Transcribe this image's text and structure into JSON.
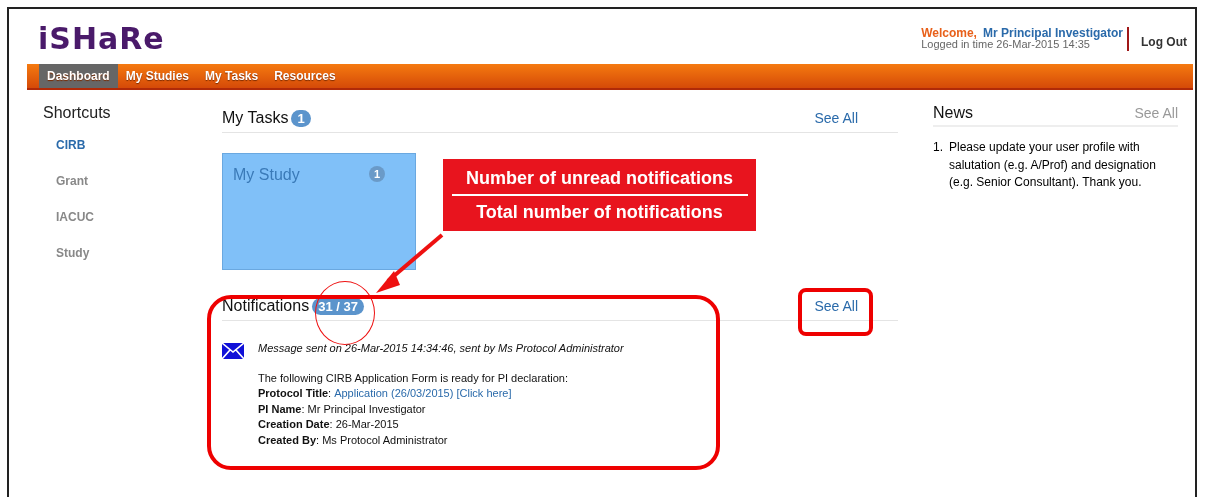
{
  "header": {
    "logo": "iSHaRe",
    "welcome": "Welcome,",
    "user": "Mr Principal Investigator",
    "login_time": "Logged in time 26-Mar-2015 14:35",
    "logout": "Log Out"
  },
  "nav": [
    {
      "label": "Dashboard",
      "selected": true
    },
    {
      "label": "My Studies",
      "selected": false
    },
    {
      "label": "My Tasks",
      "selected": false
    },
    {
      "label": "Resources",
      "selected": false
    }
  ],
  "sidebar": {
    "title": "Shortcuts",
    "items": [
      {
        "label": "CIRB",
        "selected": true
      },
      {
        "label": "Grant",
        "selected": false
      },
      {
        "label": "IACUC",
        "selected": false
      },
      {
        "label": "Study",
        "selected": false
      }
    ]
  },
  "tasks": {
    "title": "My Tasks",
    "count": "1",
    "see_all": "See All",
    "tiles": [
      {
        "label": "My Study",
        "count": "1"
      }
    ]
  },
  "notifications": {
    "title": "Notifications",
    "count": "31 / 37",
    "see_all": "See All",
    "items": [
      {
        "meta": "Message sent on 26-Mar-2015 14:34:46, sent by Ms Protocol Administrator",
        "intro": "The following CIRB Application Form is ready for PI declaration:",
        "fields": [
          {
            "label": "**Protocol Title**:",
            "value": "Application (26/03/2015) [Click here]",
            "kind": "link"
          },
          {
            "text": "**PI Name**: Mr Principal Investigator",
            "kind": "text"
          },
          {
            "text": "**Creation Date**: 26-Mar-2015",
            "kind": "text"
          },
          {
            "text": "**Created By**: Ms Protocol Administrator",
            "kind": "text"
          }
        ]
      }
    ]
  },
  "news": {
    "title": "News",
    "see_all": "See All",
    "items": [
      {
        "number": "1.",
        "text": "Please update your user profile with salutation (e.g. A/Prof) and designation (e.g. Senior Consultant). Thank you."
      }
    ]
  },
  "annotation": {
    "callout_lines": [
      "Number of unread notifications",
      "Total number of notifications"
    ]
  }
}
